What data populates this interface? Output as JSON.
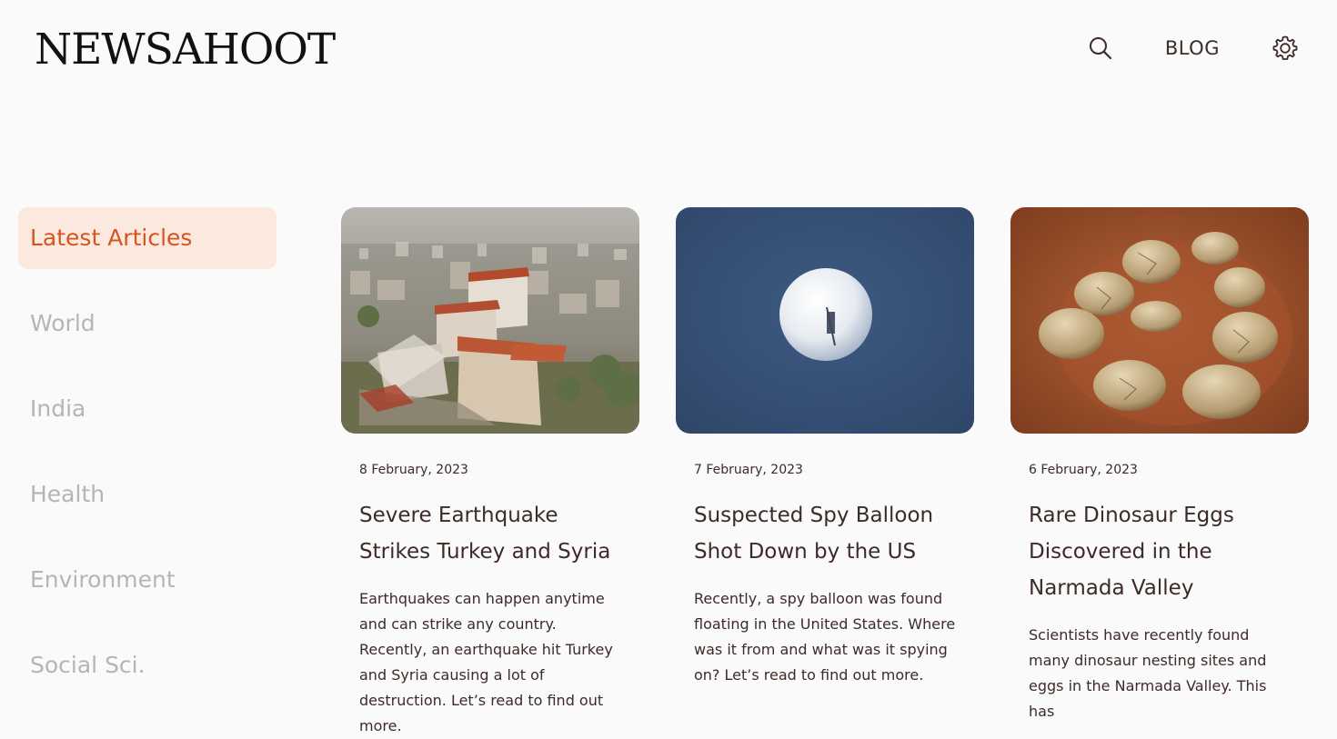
{
  "header": {
    "logo_text": "NEWSAHOOT",
    "blog_label": "BLOG",
    "icons": [
      "search-icon",
      "gear-icon"
    ]
  },
  "colors": {
    "accent": "#d4551e",
    "accent_bg": "#fbe9e0",
    "text": "#3d2b28",
    "muted": "#b9b3b1",
    "background": "#fafafa"
  },
  "sidebar": {
    "items": [
      {
        "label": "Latest Articles",
        "active": true
      },
      {
        "label": "World"
      },
      {
        "label": "India"
      },
      {
        "label": "Health"
      },
      {
        "label": "Environment"
      },
      {
        "label": "Social Sci."
      }
    ]
  },
  "articles": [
    {
      "date": "8 February, 2023",
      "title": "Severe Earthquake Strikes Turkey and Syria",
      "excerpt": "Earthquakes can happen anytime and can strike any country. Recently, an earthquake hit Turkey and Syria causing a lot of destruction. Let’s read to find out more."
    },
    {
      "date": "7 February, 2023",
      "title": "Suspected Spy Balloon Shot Down by the US",
      "excerpt": "Recently, a spy balloon was found floating in the United States. Where was it from and what was it spying on? Let’s read to find out more."
    },
    {
      "date": "6 February, 2023",
      "title": "Rare Dinosaur Eggs Discovered in the Narmada Valley",
      "excerpt": "Scientists have recently found many dinosaur nesting sites and eggs in the Narmada Valley. This has"
    }
  ]
}
